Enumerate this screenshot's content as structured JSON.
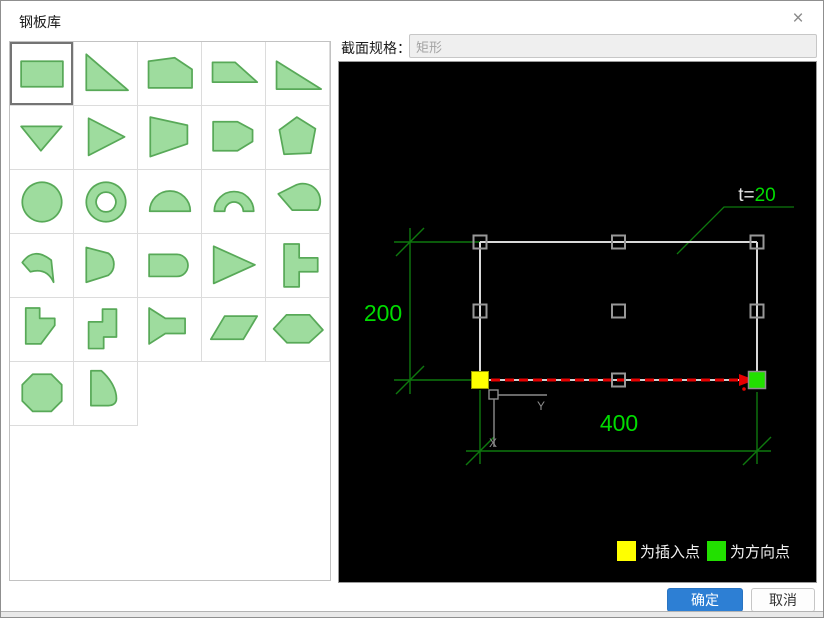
{
  "window": {
    "title": "钢板库",
    "close_icon": "×"
  },
  "spec": {
    "label": "截面规格：",
    "value": "矩形"
  },
  "palette": {
    "selected_index": 0,
    "shapes": [
      "rectangle",
      "right-triangle-steep",
      "chamfered-plate",
      "top-trapezoid",
      "right-triangle-wide",
      "triangle-down",
      "triangle-right",
      "trapezoid-right",
      "hexagon-right-point",
      "pentagon",
      "circle",
      "ring",
      "half-circle",
      "half-ring",
      "circular-segment",
      "arc-band",
      "bullet",
      "rounded-end-rect",
      "triangle-right-solid",
      "tee-right",
      "notched-polygon",
      "stair-shape",
      "funnel",
      "parallelogram",
      "hexagon-elongated",
      "octagon",
      "curved-wedge"
    ]
  },
  "preview": {
    "height_dim": "200",
    "width_dim": "400",
    "thickness_prefix": "t=",
    "thickness_value": "20",
    "axis_x": "X",
    "axis_y": "Y",
    "legend_insert_label": "为插入点",
    "legend_direction_label": "为方向点",
    "legend_insert_color": "#ffff00",
    "legend_direction_color": "#22e000"
  },
  "colors": {
    "shape_fill": "#9edc9e",
    "shape_stroke": "#58a958",
    "dim_line": "#0e780e",
    "dim_text": "#00dc00",
    "arrow": "#e60000",
    "ok_button": "#2d7fd4",
    "canvas_bg": "#000000"
  },
  "buttons": {
    "ok": "确定",
    "cancel": "取消"
  }
}
